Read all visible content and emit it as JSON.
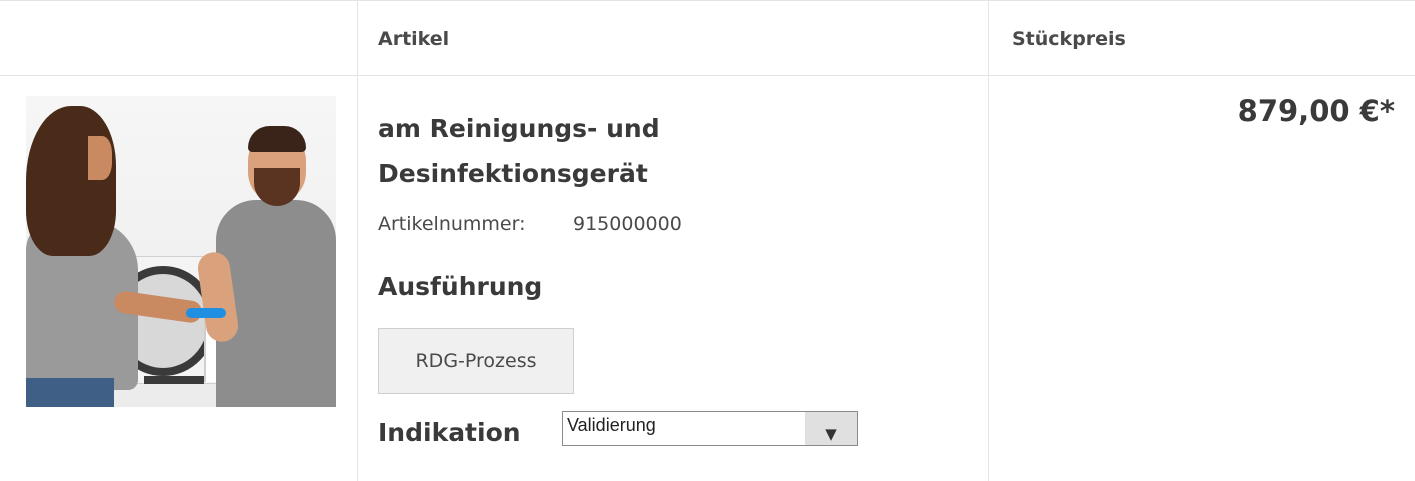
{
  "table": {
    "headers": {
      "article": "Artikel",
      "unit_price": "Stückpreis"
    }
  },
  "product": {
    "title": "am Reinigungs- und Desinfektionsgerät",
    "article_number_label": "Artikelnummer:",
    "article_number": "915000000",
    "variant_heading": "Ausführung",
    "variant_option": "RDG-Prozess",
    "indication_heading": "Indikation",
    "indication_selected": "Validierung",
    "dropdown_icon": "▼",
    "price": "879,00 €*"
  }
}
